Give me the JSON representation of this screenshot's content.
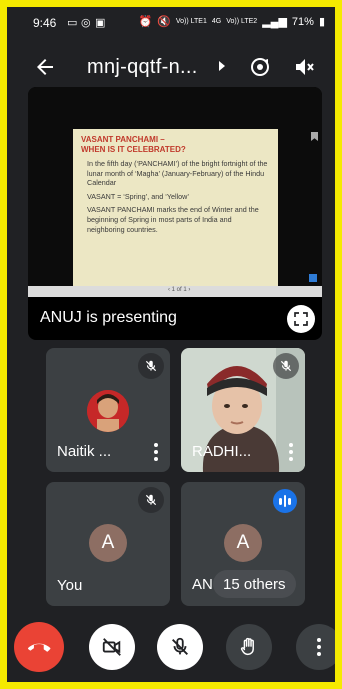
{
  "status_bar": {
    "time": "9:46",
    "network_labels": [
      "Vo)) LTE1",
      "4G",
      "Vo)) LTE2"
    ],
    "battery": "71%"
  },
  "header": {
    "meeting_code": "mnj-qqtf-n..."
  },
  "presentation": {
    "slide": {
      "heading_line1": "VASANT PANCHAMI –",
      "heading_line2": "WHEN IS IT CELEBRATED?",
      "para1": "In the fifth day (‘PANCHAMI’) of the bright fortnight of the lunar month of ‘Magha’ (January-February) of the Hindu Calendar",
      "para2": "VASANT = ‘Spring’, and ‘Yellow’",
      "para3": "VASANT PANCHAMI marks the end of Winter and the beginning of Spring in most parts of India and neighboring countries.",
      "nav_label": "‹  1 of 1  ›"
    },
    "presenter_text": "ANUJ is presenting"
  },
  "tiles": [
    {
      "name": "Naitik ...",
      "muted": true
    },
    {
      "name": "RADHI...",
      "muted": true
    },
    {
      "name": "You",
      "avatar_letter": "A",
      "muted": true
    },
    {
      "name_partial": "ANI",
      "avatar_letter": "A",
      "speaking": true,
      "others_label": "15 others"
    }
  ],
  "colors": {
    "background": "#202124",
    "tile": "#3c4043",
    "end_call": "#ea4335",
    "accent_blue": "#1a73e8",
    "avatar": "#8d6e63",
    "frame": "#f5ea00"
  },
  "controls": {
    "icons": [
      "end-call-icon",
      "camera-off-icon",
      "mic-off-icon",
      "raise-hand-icon",
      "more-vert-icon"
    ]
  }
}
